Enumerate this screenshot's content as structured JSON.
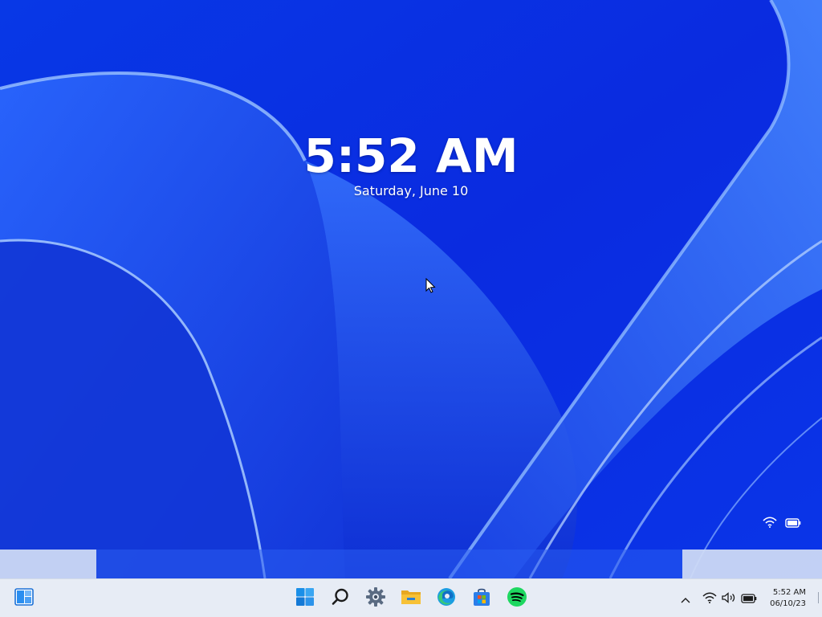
{
  "lockscreen": {
    "time": "5:52 AM",
    "date": "Saturday, June 10",
    "status_icons": [
      "wifi-icon",
      "battery-icon"
    ]
  },
  "taskbar": {
    "left_icon": "widgets-icon",
    "pinned": [
      {
        "id": "start",
        "icon": "windows-start-icon",
        "color": "#1a8fe8"
      },
      {
        "id": "search",
        "icon": "search-icon",
        "color": "#1b1b1b"
      },
      {
        "id": "settings",
        "icon": "gear-icon",
        "color": "#5a6b82"
      },
      {
        "id": "file-explorer",
        "icon": "folder-icon",
        "color": "#f7c137"
      },
      {
        "id": "edge",
        "icon": "edge-icon",
        "color": "#1b9de2"
      },
      {
        "id": "store",
        "icon": "store-icon",
        "color": "#2b7de9"
      },
      {
        "id": "spotify",
        "icon": "spotify-icon",
        "color": "#1ed760"
      }
    ],
    "tray": {
      "icons": [
        "chevron-up-icon",
        "wifi-icon",
        "volume-icon",
        "battery-icon"
      ],
      "time": "5:52 AM",
      "date": "06/10/23"
    }
  },
  "colors": {
    "wallpaper_base": "#0a2fe0",
    "taskbar_bg": "#e7ecf5"
  }
}
